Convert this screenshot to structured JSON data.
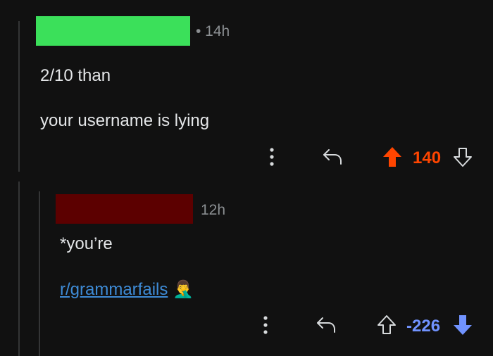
{
  "comments": [
    {
      "timestamp": "• 14h",
      "lines": [
        "2/10 than",
        "your username is lying"
      ],
      "score": "140",
      "vote_state": "upvoted",
      "score_color": "#ff4500",
      "username_redaction_color": "#3be05a"
    },
    {
      "timestamp": "12h",
      "lines": [
        "*you’re"
      ],
      "link_text": "r/grammarfails",
      "emoji": "🤦‍♂️",
      "score": "-226",
      "vote_state": "downvoted",
      "score_color": "#7193ff",
      "username_redaction_color": "#5c0000"
    }
  ],
  "icons": {
    "more": "more-vertical-icon",
    "reply": "reply-arrow-icon",
    "upvote": "upvote-arrow-icon",
    "downvote": "downvote-arrow-icon"
  }
}
